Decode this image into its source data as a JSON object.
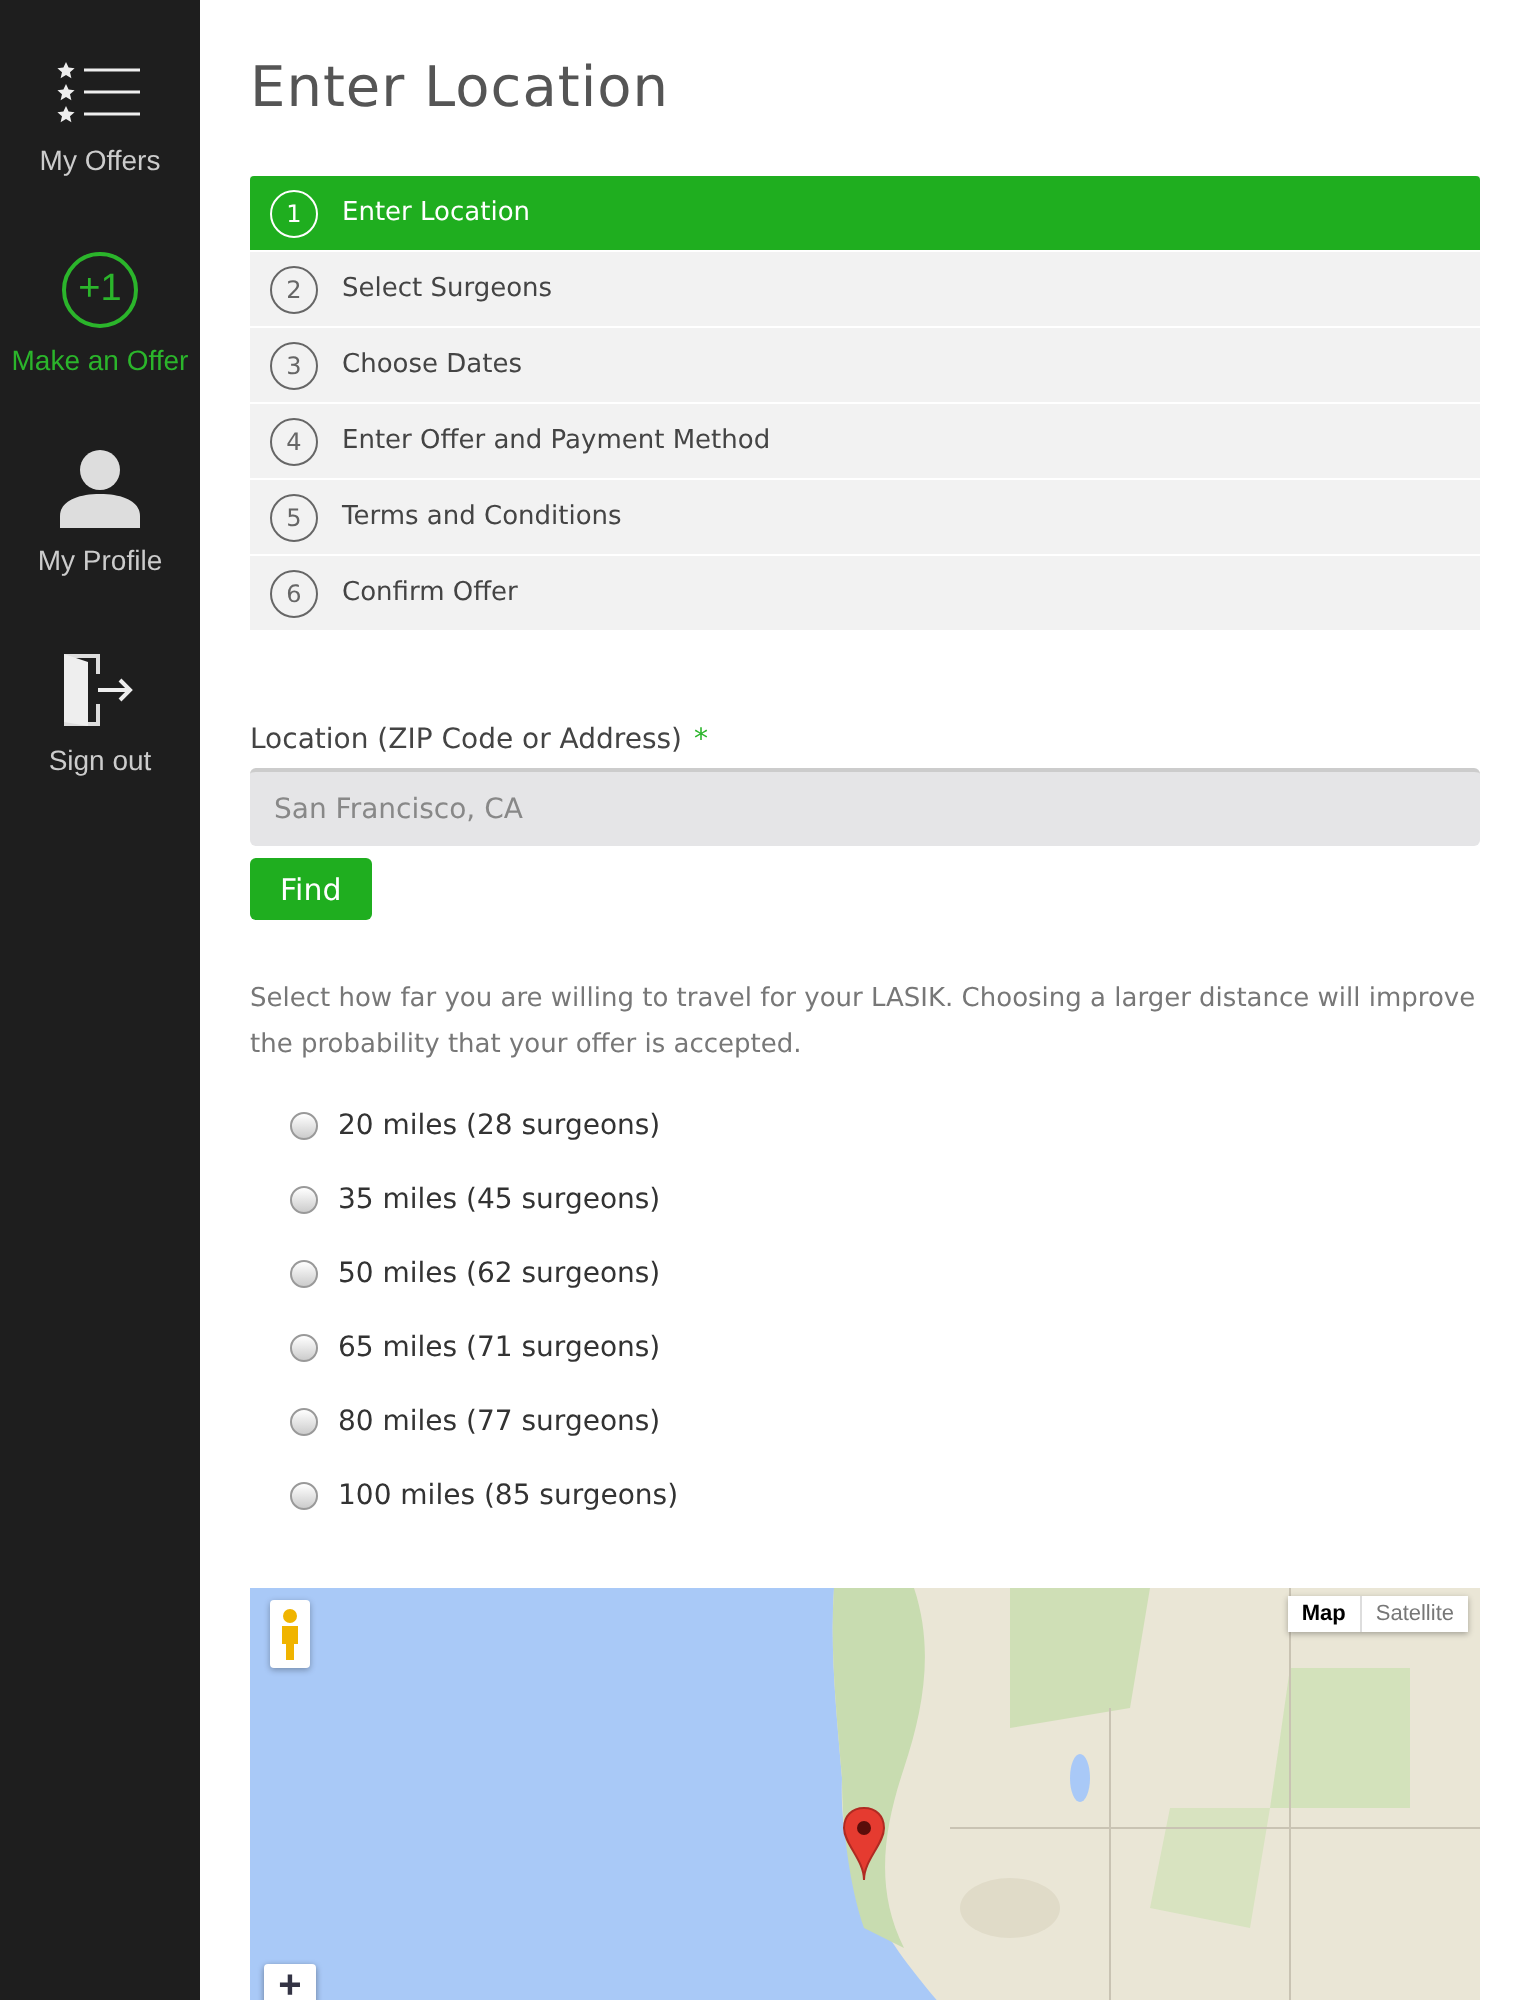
{
  "sidebar": {
    "items": [
      {
        "label": "My Offers",
        "kind": "list",
        "selected": false
      },
      {
        "label": "Make an Offer",
        "kind": "badge",
        "badge": "+1",
        "selected": true
      },
      {
        "label": "My Profile",
        "kind": "profile",
        "selected": false
      },
      {
        "label": "Sign out",
        "kind": "exit",
        "selected": false
      }
    ]
  },
  "title": "Enter Location",
  "steps": [
    {
      "number": "1",
      "label": "Enter Location",
      "selected": true
    },
    {
      "number": "2",
      "label": "Select Surgeons",
      "selected": false
    },
    {
      "number": "3",
      "label": "Choose Dates",
      "selected": false
    },
    {
      "number": "4",
      "label": "Enter Offer and Payment Method",
      "selected": false
    },
    {
      "number": "5",
      "label": "Terms and Conditions",
      "selected": false
    },
    {
      "number": "6",
      "label": "Confirm Offer",
      "selected": false
    }
  ],
  "location": {
    "label": "Location (ZIP Code or Address)",
    "required_mark": "*",
    "placeholder": "San Francisco, CA",
    "button": "Find"
  },
  "distance_hint": "Select how far you are willing to travel for your LASIK. Choosing a larger distance will improve the probability that your offer is accepted.",
  "distances": [
    {
      "label": "20 miles (28 surgeons)",
      "selected": false
    },
    {
      "label": "35 miles (45 surgeons)",
      "selected": false
    },
    {
      "label": "50 miles (62 surgeons)",
      "selected": false
    },
    {
      "label": "65 miles (71 surgeons)",
      "selected": false
    },
    {
      "label": "80 miles (77 surgeons)",
      "selected": false
    },
    {
      "label": "100 miles (85 surgeons)",
      "selected": false
    }
  ],
  "map": {
    "kind": "picture",
    "types": [
      {
        "label": "Map",
        "selected": true
      },
      {
        "label": "Satellite",
        "selected": false
      }
    ],
    "zoom_in": "+"
  }
}
